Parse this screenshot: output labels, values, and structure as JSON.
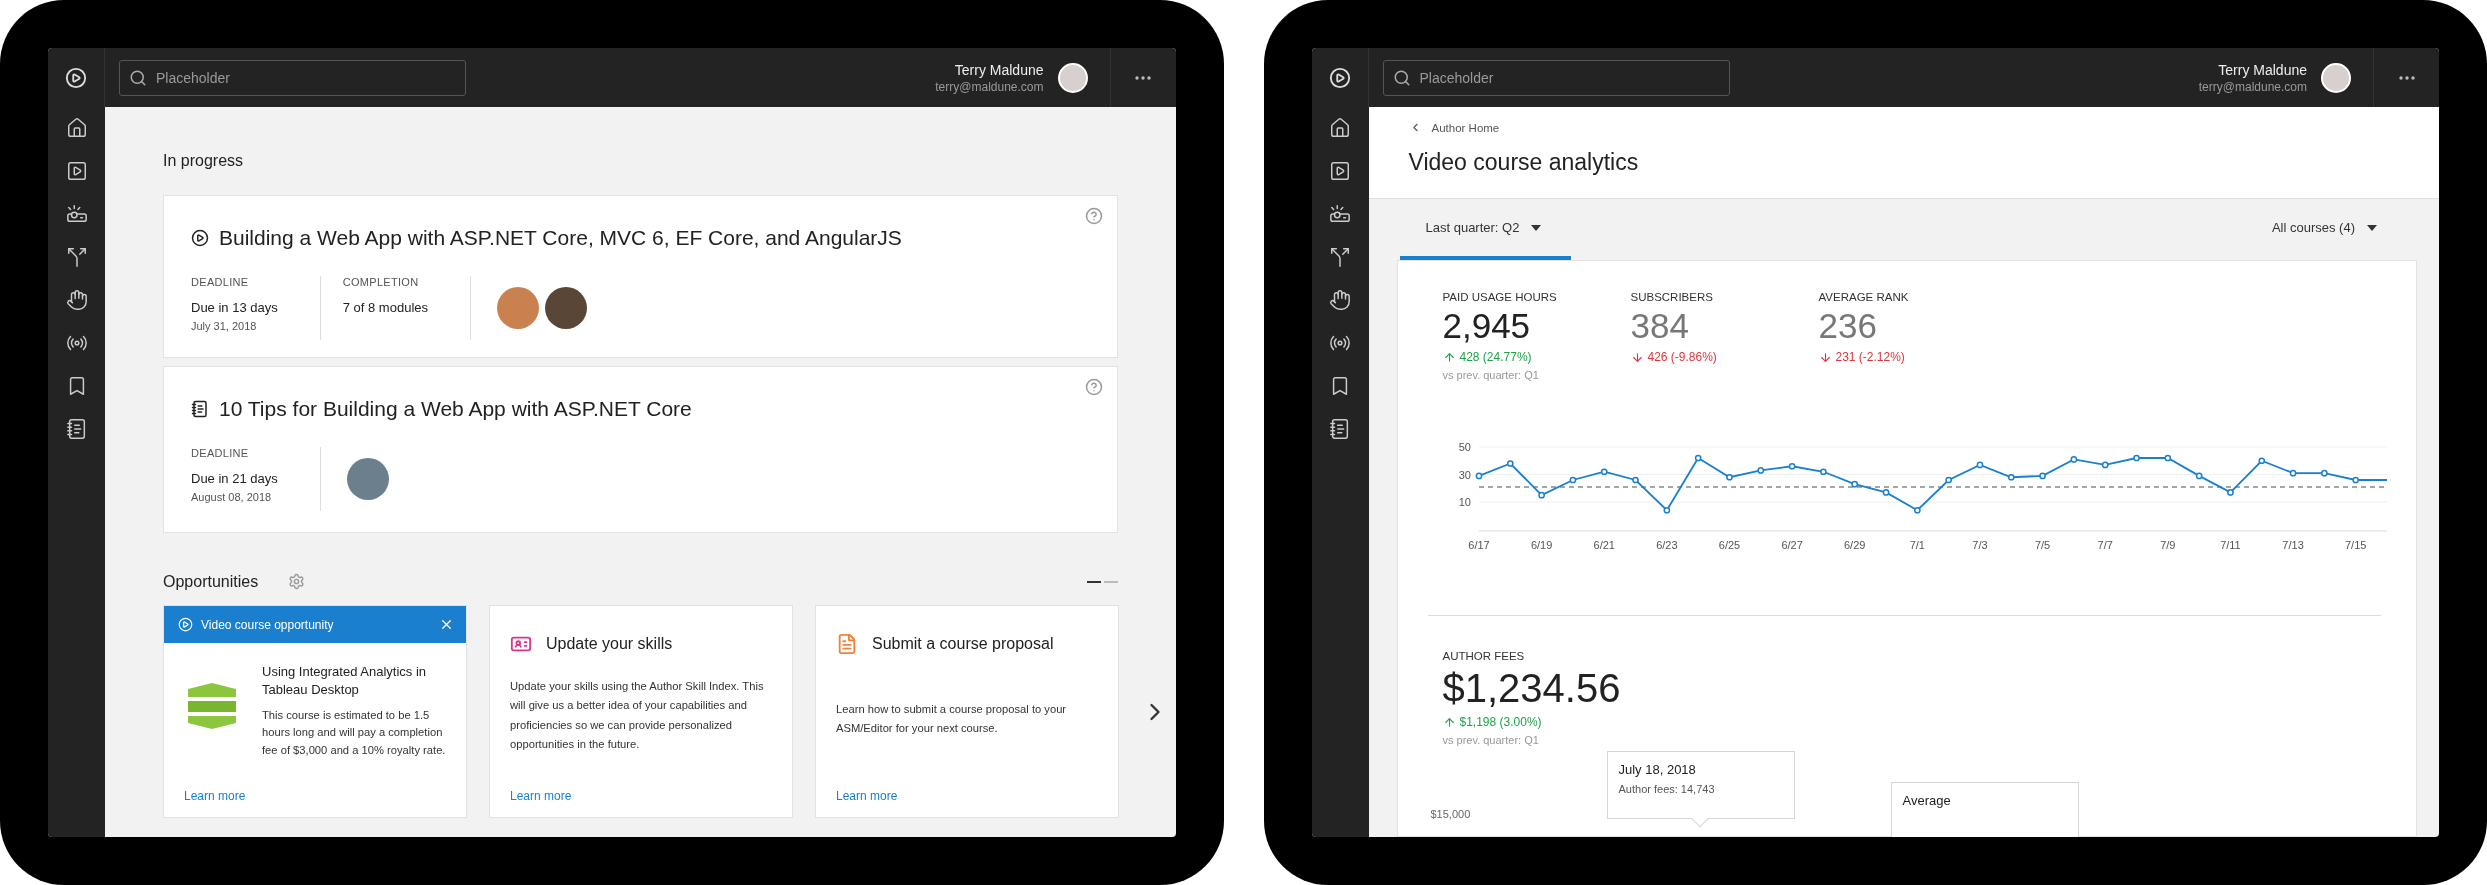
{
  "devices": [
    {
      "topbar": {
        "search": {
          "placeholder": "Placeholder"
        },
        "user": {
          "name": "Terry Maldune",
          "email": "terry@maldune.com"
        }
      },
      "content": {
        "kind": "home",
        "in_progress": {
          "title": "In progress",
          "courses": [
            {
              "kind": "video",
              "title": "Building a Web App with ASP.NET Core, MVC 6, EF Core, and AngularJS",
              "deadline": {
                "label": "DEADLINE",
                "value": "Due in 13 days",
                "date": "July 31, 2018"
              },
              "completion": {
                "label": "COMPLETION",
                "value": "7 of 8 modules"
              },
              "authors": [
                {
                  "color": "#c9824f"
                },
                {
                  "color": "#5a4636"
                }
              ]
            },
            {
              "kind": "guide",
              "title": "10 Tips for Building a Web App with ASP.NET Core",
              "deadline": {
                "label": "DEADLINE",
                "value": "Due in 21 days",
                "date": "August 08, 2018"
              },
              "authors": [
                {
                  "color": "#6b7f8c"
                }
              ]
            }
          ]
        },
        "opportunities": {
          "title": "Opportunities",
          "pager": [
            {
              "selected": true
            },
            {
              "selected": false
            }
          ],
          "cards": [
            {
              "kind": "featured",
              "banner": "Video course opportunity",
              "title": "Using Integrated Analytics in Tableau Desktop",
              "body": "This course is estimated to be 1.5 hours long and will pay a completion fee of $3,000 and a 10% royalty rate.",
              "link": "Learn more"
            },
            {
              "kind": "skills",
              "title": "Update your skills",
              "body": "Update your skills using the Author Skill Index. This will give us a better idea of your capabilities and proficiencies so we can provide personalized opportunities in the future.",
              "link": "Learn more"
            },
            {
              "kind": "proposal",
              "title": "Submit a course proposal",
              "body": "Learn how to submit a course proposal to your ASM/Editor for your next course.",
              "link": "Learn more"
            }
          ]
        }
      }
    },
    {
      "topbar": {
        "search": {
          "placeholder": "Placeholder"
        },
        "user": {
          "name": "Terry Maldune",
          "email": "terry@maldune.com"
        }
      },
      "content": {
        "kind": "analytics",
        "breadcrumb": "Author Home",
        "title": "Video course analytics",
        "filters": [
          {
            "label": "Last quarter: Q2",
            "selected": true
          },
          {
            "label": "All courses (4)",
            "selected": false
          }
        ],
        "stats": [
          {
            "label": "PAID USAGE HOURS",
            "value": "2,945",
            "change": "428 (24.77%)",
            "increase": true,
            "note": "vs prev. quarter: Q1",
            "selected": true
          },
          {
            "label": "SUBSCRIBERS",
            "value": "384",
            "change": "426 (-9.86%)",
            "increase": false,
            "selected": false
          },
          {
            "label": "AVERAGE RANK",
            "value": "236",
            "change": "231 (-2.12%)",
            "increase": false,
            "selected": false
          }
        ],
        "chart_data": {
          "type": "line",
          "categories": [
            "6/17",
            null,
            "6/19",
            null,
            "6/21",
            null,
            "6/23",
            null,
            "6/25",
            null,
            "6/27",
            null,
            "6/29",
            null,
            "7/1",
            null,
            "7/3",
            null,
            "7/5",
            null,
            "7/7",
            null,
            "7/9",
            null,
            "7/11",
            null,
            "7/13",
            null,
            "7/15",
            null
          ],
          "series": [
            {
              "color": "#1a7fcf",
              "marker": "circle",
              "values": [
                29,
                38,
                15,
                26,
                32,
                26,
                4,
                42,
                28,
                33,
                36,
                32,
                23,
                17,
                4,
                26,
                37,
                28,
                29,
                41,
                37,
                42,
                42,
                29,
                17,
                40,
                31,
                31,
                26,
                26
              ]
            },
            {
              "color": "#888888",
              "line_style": "dashed",
              "values": [
                21,
                21,
                21,
                21,
                21,
                21,
                21,
                21,
                21,
                21,
                21,
                21,
                21,
                21,
                21,
                21,
                21,
                21,
                21,
                21,
                21,
                21,
                21,
                21,
                21,
                21,
                21,
                21,
                21,
                21
              ]
            }
          ],
          "ylim": [
            -11,
            50
          ],
          "yticks": [
            10,
            30,
            50
          ]
        },
        "author_fees": {
          "label": "AUTHOR FEES",
          "value": "$1,234.56",
          "change": "$1,198 (3.00%)",
          "increase": true,
          "note": "vs prev. quarter: Q1"
        },
        "fees_chart": {
          "axis_label": "$15,000",
          "tooltips": [
            {
              "title": "July 18, 2018",
              "text": "Author fees: 14,743"
            },
            {
              "title": "Average"
            }
          ]
        }
      }
    }
  ]
}
